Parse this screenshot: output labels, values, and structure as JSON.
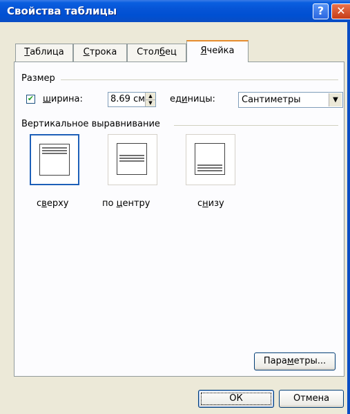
{
  "window": {
    "title": "Свойства таблицы",
    "help_glyph": "?",
    "close_glyph": "✕"
  },
  "tabs": [
    {
      "label_pre": "",
      "label_u": "Т",
      "label_post": "аблица"
    },
    {
      "label_pre": "",
      "label_u": "С",
      "label_post": "трока"
    },
    {
      "label_pre": "Стол",
      "label_u": "б",
      "label_post": "ец"
    },
    {
      "label_pre": "",
      "label_u": "Я",
      "label_post": "чейка"
    }
  ],
  "size_group": {
    "label": "Размер",
    "width_checked": true,
    "width_label_u": "ш",
    "width_label_post": "ирина:",
    "width_value": "8.69 см",
    "units_label_pre": "ед",
    "units_label_u": "и",
    "units_label_post": "ницы:",
    "units_value": "Сантиметры"
  },
  "valign_group": {
    "label": "Вертикальное выравнивание",
    "options": [
      {
        "pre": "с",
        "u": "в",
        "post": "ерху"
      },
      {
        "pre": "по ",
        "u": "ц",
        "post": "ентру"
      },
      {
        "pre": "с",
        "u": "н",
        "post": "изу"
      }
    ],
    "selected_index": 0
  },
  "buttons": {
    "params_pre": "Пара",
    "params_u": "м",
    "params_post": "етры...",
    "ok": "ОК",
    "cancel": "Отмена"
  },
  "colors": {
    "titlebar": "#0054e3",
    "tab_highlight": "#e68b2c",
    "selection_border": "#1c5fb8"
  }
}
